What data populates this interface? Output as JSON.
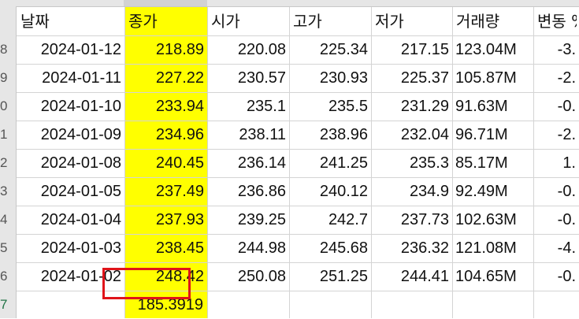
{
  "sheet": {
    "row_numbers": [
      "8",
      "9",
      "0",
      "1",
      "2",
      "3",
      "4",
      "5",
      "6",
      "7"
    ],
    "headers": [
      "날짜",
      "종가",
      "시가",
      "고가",
      "저가",
      "거래량",
      "변동 %"
    ],
    "rows": [
      [
        "2024-01-12",
        "218.89",
        "220.08",
        "225.34",
        "217.15",
        "123.04M",
        "-3."
      ],
      [
        "2024-01-11",
        "227.22",
        "230.57",
        "230.93",
        "225.37",
        "105.87M",
        "-2."
      ],
      [
        "2024-01-10",
        "233.94",
        "235.1",
        "235.5",
        "231.29",
        "91.63M",
        "-0."
      ],
      [
        "2024-01-09",
        "234.96",
        "238.11",
        "238.96",
        "232.04",
        "96.71M",
        "-2."
      ],
      [
        "2024-01-08",
        "240.45",
        "236.14",
        "241.25",
        "235.3",
        "85.17M",
        "1."
      ],
      [
        "2024-01-05",
        "237.49",
        "236.86",
        "240.12",
        "234.9",
        "92.49M",
        "-0."
      ],
      [
        "2024-01-04",
        "237.93",
        "239.25",
        "242.7",
        "237.73",
        "102.63M",
        "-0."
      ],
      [
        "2024-01-03",
        "238.45",
        "244.98",
        "245.68",
        "236.32",
        "121.08M",
        "-4."
      ],
      [
        "2024-01-02",
        "248.42",
        "250.08",
        "251.25",
        "244.41",
        "104.65M",
        "-0."
      ]
    ],
    "result_cell": "185.3919",
    "highlight_color": "#ffff00",
    "selection_border_color": "#e0141a"
  }
}
